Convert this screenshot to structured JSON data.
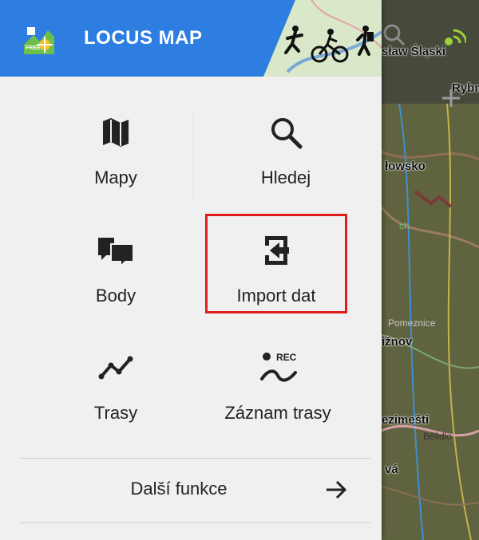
{
  "header": {
    "title": "LOCUS MAP",
    "badge": "FREE"
  },
  "menu": {
    "items": [
      {
        "id": "maps",
        "label": "Mapy",
        "icon": "map-icon"
      },
      {
        "id": "search",
        "label": "Hledej",
        "icon": "search-icon"
      },
      {
        "id": "points",
        "label": "Body",
        "icon": "points-icon"
      },
      {
        "id": "import",
        "label": "Import dat",
        "icon": "import-icon"
      },
      {
        "id": "tracks",
        "label": "Trasy",
        "icon": "track-icon"
      },
      {
        "id": "record",
        "label": "Záznam trasy",
        "icon": "record-track-icon",
        "badge": "REC"
      }
    ],
    "more": {
      "label": "Další funkce"
    }
  },
  "map": {
    "labels": [
      "sław Śląski",
      "Rybn",
      "łowsko",
      "Pomeznice",
      "ižnov",
      "ezimešti",
      "Bělidlo",
      "vá",
      "ch"
    ]
  },
  "colors": {
    "accent": "#2d7ee0",
    "highlight": "#e01d1d",
    "drawer": "#f0f0f0",
    "text": "#222222"
  }
}
